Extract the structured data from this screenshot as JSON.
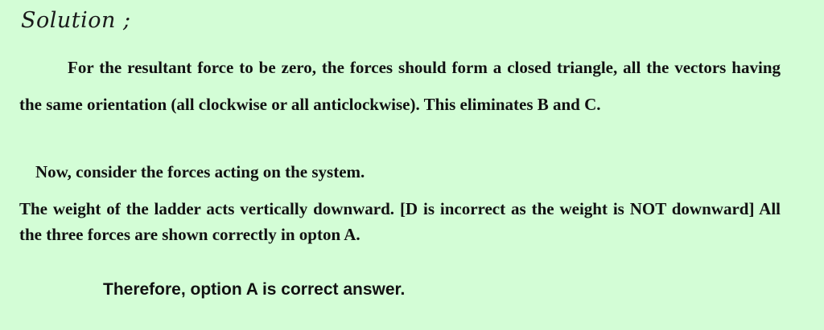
{
  "solution": {
    "heading": "Solution ;",
    "paragraph_1": "For the resultant force to be zero, the forces should form a closed triangle, all the vectors having the same orientation (all clockwise or all anticlockwise). This eliminates B and C.",
    "paragraph_2": "Now, consider the forces acting on the system.",
    "paragraph_3": "The weight of the ladder acts vertically downward. [D is incorrect as the weight is NOT downward]  All the three forces are shown correctly in opton A.",
    "conclusion": "Therefore, option A is correct answer."
  }
}
